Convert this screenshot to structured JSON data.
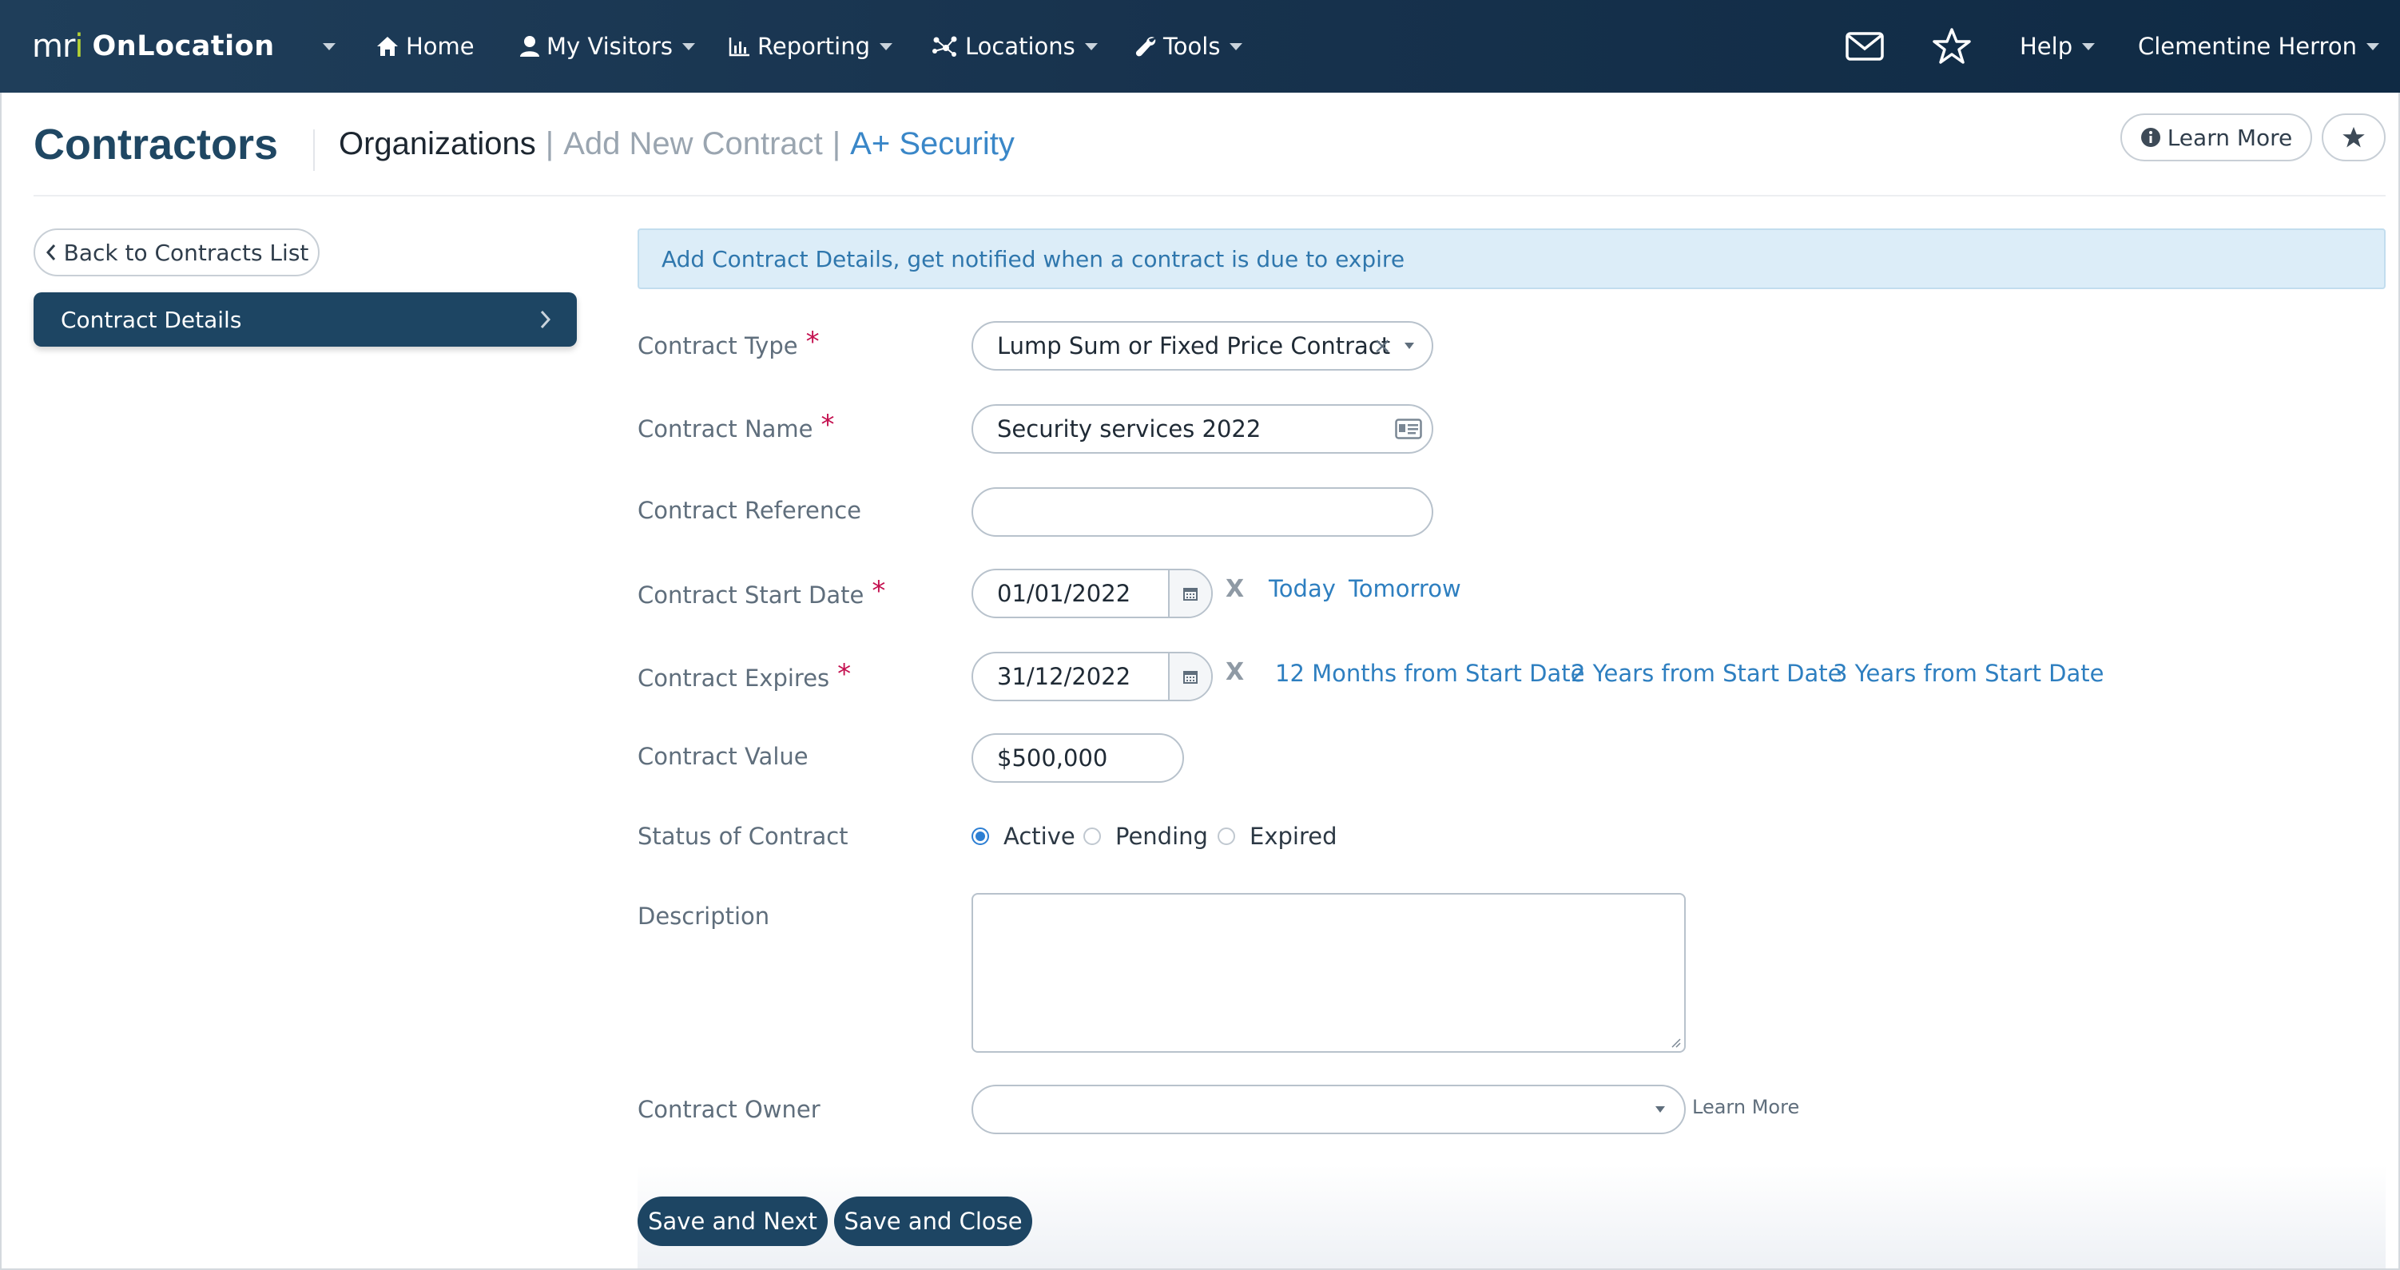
{
  "navbar": {
    "brand_logo": "mri",
    "brand_name": "OnLocation",
    "items": [
      {
        "label": "Home",
        "icon": "home-icon"
      },
      {
        "label": "My Visitors",
        "icon": "user-icon"
      },
      {
        "label": "Reporting",
        "icon": "bar-chart-icon"
      },
      {
        "label": "Locations",
        "icon": "network-icon"
      },
      {
        "label": "Tools",
        "icon": "wrench-icon"
      }
    ],
    "help_label": "Help",
    "user_name": "Clementine Herron"
  },
  "header": {
    "title": "Contractors",
    "breadcrumbs": [
      "Organizations",
      "Add New Contract",
      "A+ Security"
    ],
    "separator": "|",
    "learn_more_label": "Learn More"
  },
  "sidebar": {
    "back_label": "Back to Contracts List",
    "active_item": "Contract Details"
  },
  "form": {
    "info_text": "Add Contract Details, get notified when a contract is due to expire",
    "required_marker": "*",
    "clear_marker": "X",
    "fields": {
      "contract_type": {
        "label": "Contract Type",
        "value": "Lump Sum or Fixed Price Contract",
        "clear": "×"
      },
      "contract_name": {
        "label": "Contract Name",
        "value": "Security services 2022"
      },
      "contract_reference": {
        "label": "Contract Reference",
        "value": ""
      },
      "start_date": {
        "label": "Contract Start Date",
        "value": "01/01/2022",
        "quick_links": [
          "Today",
          "Tomorrow"
        ]
      },
      "expires": {
        "label": "Contract Expires",
        "value": "31/12/2022",
        "quick_links": [
          "12 Months from Start Date",
          "2 Years from Start Date",
          "3 Years from Start Date"
        ]
      },
      "value": {
        "label": "Contract Value",
        "value": "$500,000"
      },
      "status": {
        "label": "Status of Contract",
        "options": [
          "Active",
          "Pending",
          "Expired"
        ],
        "selected": "Active"
      },
      "description": {
        "label": "Description",
        "value": ""
      },
      "owner": {
        "label": "Contract Owner",
        "value": "",
        "learn_more": "Learn More"
      }
    },
    "buttons": {
      "save_next": "Save and Next",
      "save_close": "Save and Close"
    }
  },
  "colors": {
    "navbar": "#17324d",
    "primary": "#1d4563",
    "link": "#2e7fc0",
    "required": "#c4104f",
    "info_bg": "#dcedf8"
  }
}
